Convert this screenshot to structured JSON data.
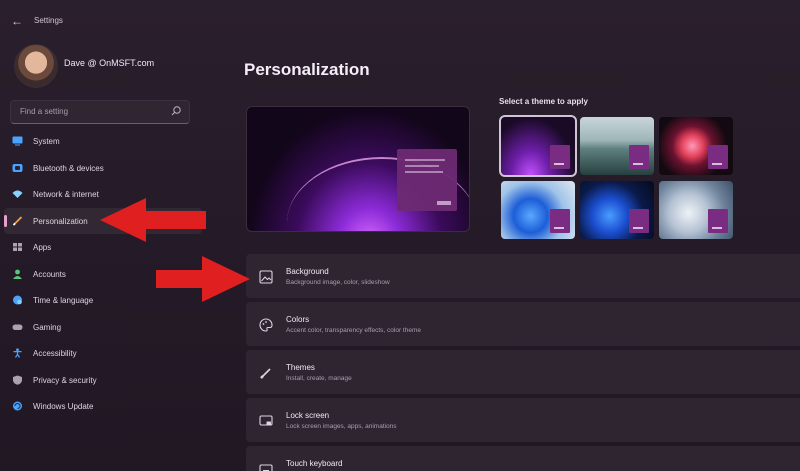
{
  "app": {
    "title": "Settings"
  },
  "user": {
    "name": "Dave @ OnMSFT.com"
  },
  "search": {
    "placeholder": "Find a setting"
  },
  "nav": [
    {
      "label": "System",
      "icon": "monitor-icon",
      "color": "#4aa3ff"
    },
    {
      "label": "Bluetooth & devices",
      "icon": "bluetooth-icon",
      "color": "#4aa3ff"
    },
    {
      "label": "Network & internet",
      "icon": "wifi-icon",
      "color": "#8bd0ff"
    },
    {
      "label": "Personalization",
      "icon": "pen-icon",
      "color": "#f0a24a",
      "active": true
    },
    {
      "label": "Apps",
      "icon": "apps-icon",
      "color": "#a9a3b0"
    },
    {
      "label": "Accounts",
      "icon": "person-icon",
      "color": "#5ac67a"
    },
    {
      "label": "Time & language",
      "icon": "globe-clock-icon",
      "color": "#4aa3ff"
    },
    {
      "label": "Gaming",
      "icon": "controller-icon",
      "color": "#a9a3b0"
    },
    {
      "label": "Accessibility",
      "icon": "accessibility-icon",
      "color": "#4aa3ff"
    },
    {
      "label": "Privacy & security",
      "icon": "shield-icon",
      "color": "#a9a3b0"
    },
    {
      "label": "Windows Update",
      "icon": "update-icon",
      "color": "#4aa3ff"
    }
  ],
  "main": {
    "title": "Personalization",
    "themes_label": "Select a theme to apply"
  },
  "themes": [
    {
      "name": "glow-dark",
      "selected": true
    },
    {
      "name": "lake"
    },
    {
      "name": "flower"
    },
    {
      "name": "bloom-light"
    },
    {
      "name": "bloom-dark"
    },
    {
      "name": "flow"
    }
  ],
  "items": [
    {
      "title": "Background",
      "subtitle": "Background image, color, slideshow",
      "icon": "image-icon"
    },
    {
      "title": "Colors",
      "subtitle": "Accent color, transparency effects, color theme",
      "icon": "palette-icon"
    },
    {
      "title": "Themes",
      "subtitle": "Install, create, manage",
      "icon": "brush-icon"
    },
    {
      "title": "Lock screen",
      "subtitle": "Lock screen images, apps, animations",
      "icon": "lock-screen-icon"
    },
    {
      "title": "Touch keyboard",
      "subtitle": "",
      "icon": "keyboard-icon"
    }
  ],
  "colors": {
    "accent": "#e6a0d0",
    "arrow": "#e02020"
  }
}
